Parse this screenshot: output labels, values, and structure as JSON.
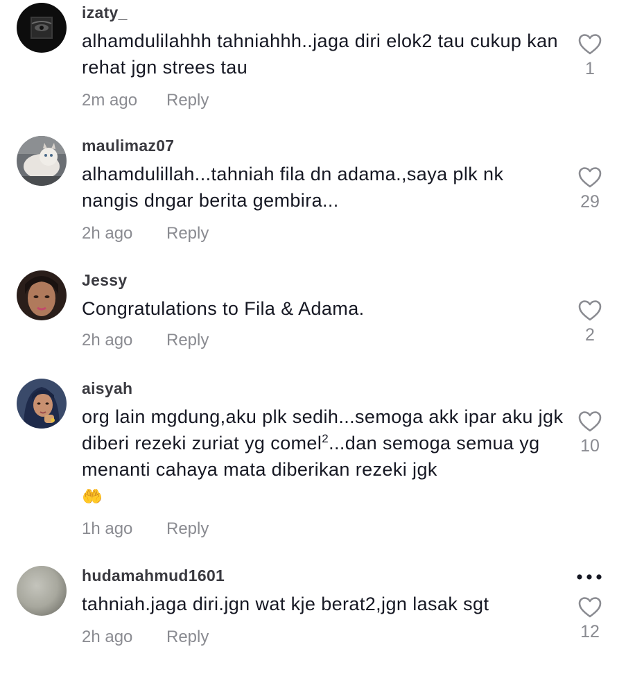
{
  "colors": {
    "text_primary": "#161823",
    "text_secondary": "#8a8b91",
    "heart_outline": "#8a8b91"
  },
  "icons": {
    "like": "heart-outline-icon",
    "more": "ellipsis-icon",
    "emoji": "raising-hands-emoji"
  },
  "comments": [
    {
      "username": "izaty_",
      "text": "alhamdulilahhh tahniahhh..jaga diri elok2 tau cukup kan rehat jgn strees tau",
      "time": "2m ago",
      "reply_label": "Reply",
      "likes": "1"
    },
    {
      "username": "maulimaz07",
      "text": "alhamdulillah...tahniah fila dn adama.,saya plk nk nangis dngar berita gembira...",
      "time": "2h ago",
      "reply_label": "Reply",
      "likes": "29"
    },
    {
      "username": "Jessy",
      "text": "Congratulations to Fila & Adama.",
      "time": "2h ago",
      "reply_label": "Reply",
      "likes": "2"
    },
    {
      "username": "aisyah",
      "text_before_sup": "org lain mgdung,aku plk sedih...semoga akk ipar aku jgk diberi rezeki zuriat yg comel",
      "text_sup": "2",
      "text_after_sup": "...dan semoga semua yg menanti cahaya mata diberikan rezeki jgk",
      "emoji": "🤲",
      "time": "1h ago",
      "reply_label": "Reply",
      "likes": "10"
    },
    {
      "username": "hudamahmud1601",
      "text": "tahniah.jaga diri.jgn wat kje berat2,jgn lasak sgt",
      "time": "2h ago",
      "reply_label": "Reply",
      "likes": "12"
    }
  ]
}
